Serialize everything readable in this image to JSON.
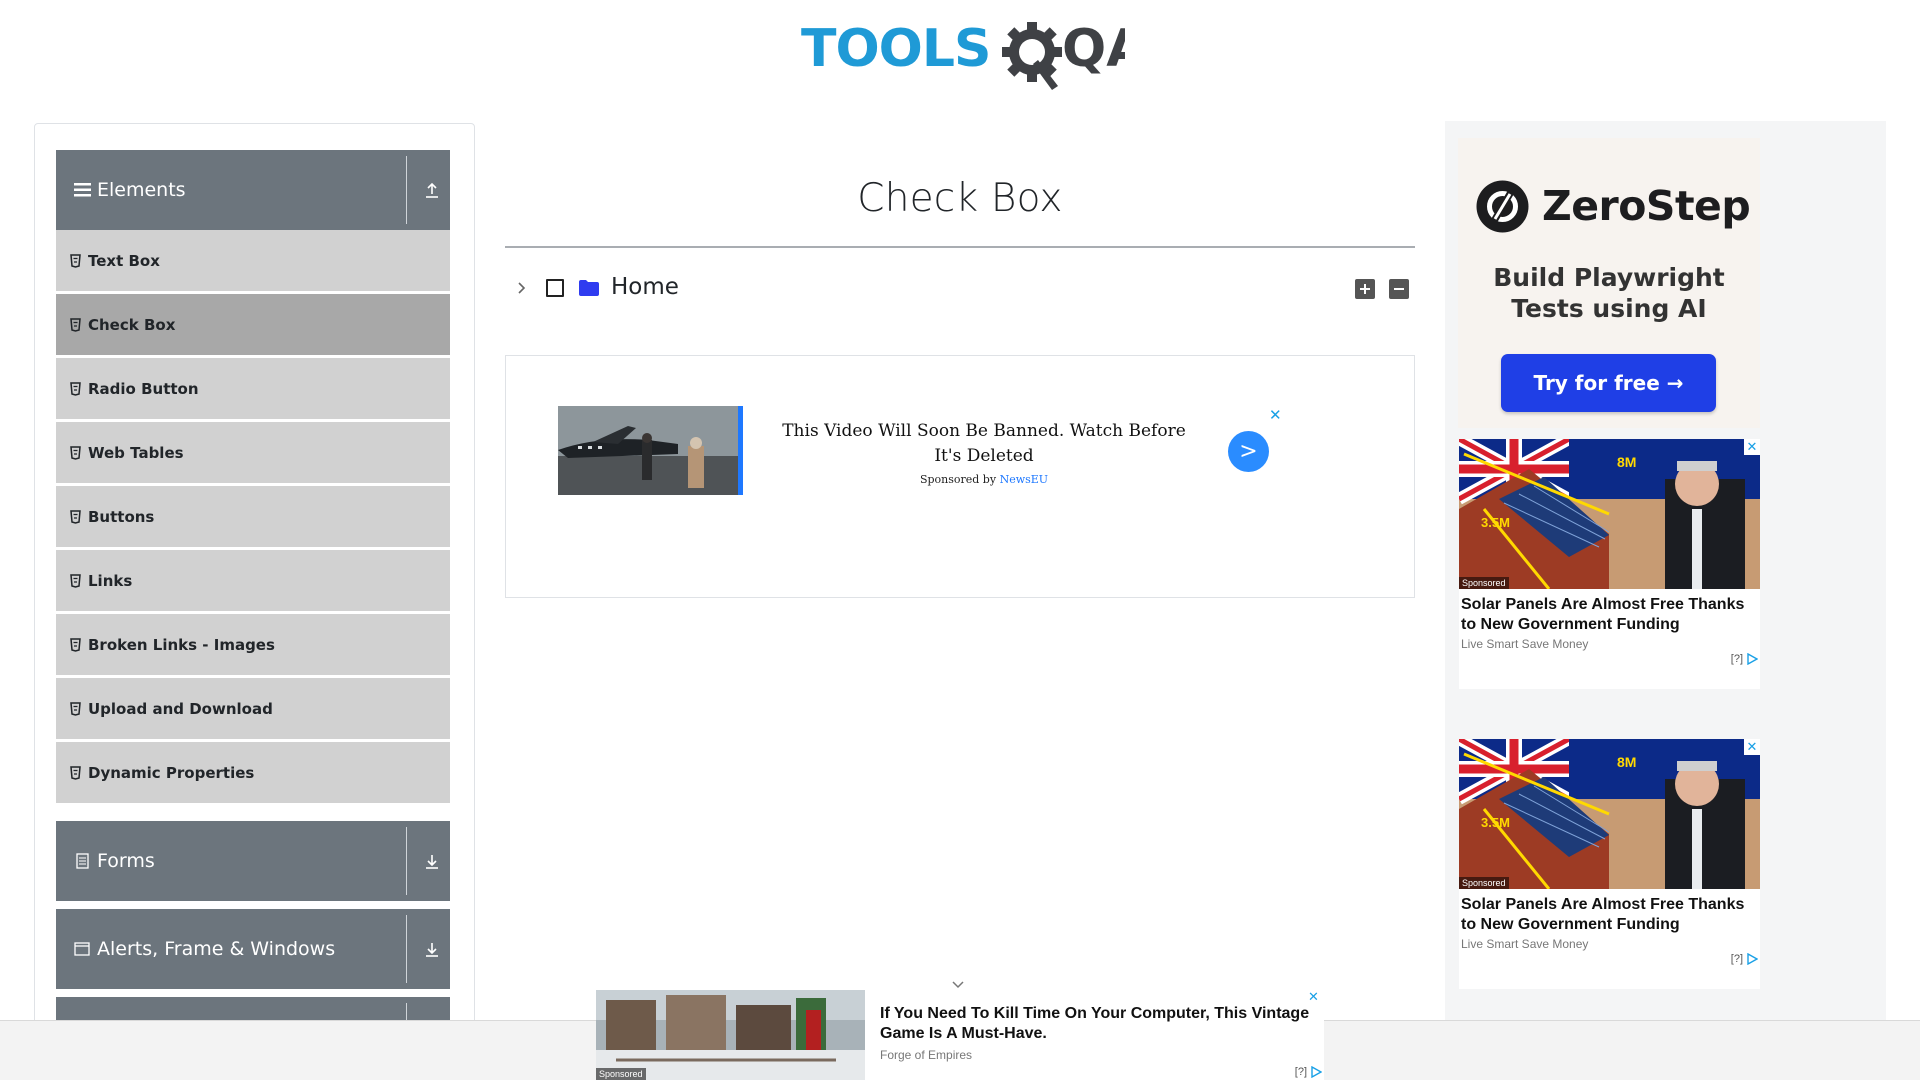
{
  "logo": {
    "text_primary": "TOOLS",
    "text_secondary": "QA"
  },
  "sidebar": {
    "groups": [
      {
        "title": "Elements",
        "icon": "hamburger-icon",
        "toggle": "upload-arrow-icon"
      },
      {
        "title": "Forms",
        "icon": "document-icon",
        "toggle": "download-arrow-icon"
      },
      {
        "title": "Alerts, Frame & Windows",
        "icon": "window-icon",
        "toggle": "download-arrow-icon"
      }
    ],
    "items": [
      {
        "label": "Text Box"
      },
      {
        "label": "Check Box",
        "active": true
      },
      {
        "label": "Radio Button"
      },
      {
        "label": "Web Tables"
      },
      {
        "label": "Buttons"
      },
      {
        "label": "Links"
      },
      {
        "label": "Broken Links - Images"
      },
      {
        "label": "Upload and Download"
      },
      {
        "label": "Dynamic Properties"
      }
    ]
  },
  "main": {
    "title": "Check Box",
    "tree": {
      "root_label": "Home",
      "expand_all": "+",
      "collapse_all": "−"
    }
  },
  "inline_ad": {
    "headline": "This Video Will Soon Be Banned. Watch Before It's Deleted",
    "sponsored_prefix": "Sponsored by",
    "sponsor": "NewsEU",
    "go": ">",
    "close": "✕"
  },
  "zerostep_ad": {
    "brand": "ZeroStep",
    "tagline": "Build Playwright Tests using AI",
    "cta": "Try for free →"
  },
  "native_ads": [
    {
      "title": "Solar Panels Are Almost Free Thanks to New Government Funding",
      "source": "Live Smart Save Money",
      "sponsored": "Sponsored",
      "figure_big": "8M",
      "figure_small": "3.5M",
      "adchoice": "[?]",
      "close": "✕"
    },
    {
      "title": "Solar Panels Are Almost Free Thanks to New Government Funding",
      "source": "Live Smart Save Money",
      "sponsored": "Sponsored",
      "figure_big": "8M",
      "figure_small": "3.5M",
      "adchoice": "[?]",
      "close": "✕"
    }
  ],
  "bottom_ad": {
    "title": "If You Need To Kill Time On Your Computer, This Vintage Game Is A Must-Have.",
    "source": "Forge of Empires",
    "sponsored": "Sponsored",
    "adchoice": "[?]",
    "close": "✕"
  },
  "colors": {
    "logo_blue": "#1f9ad6",
    "logo_dark": "#3f4145",
    "group_header": "#6c757d",
    "menu_item": "#d1d1d1",
    "menu_item_active": "#a8a8a8",
    "folder": "#2f3cf0",
    "cta_blue": "#1f3fe6"
  }
}
